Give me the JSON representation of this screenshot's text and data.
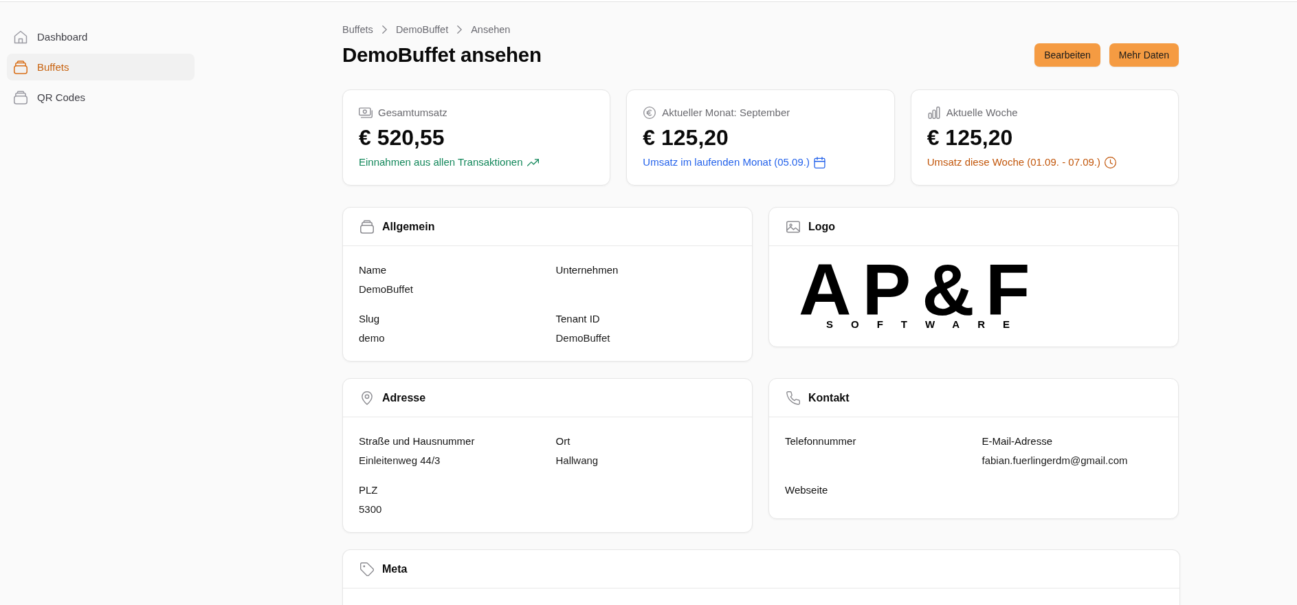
{
  "sidebar": {
    "items": [
      {
        "label": "Dashboard",
        "selected": false
      },
      {
        "label": "Buffets",
        "selected": true
      },
      {
        "label": "QR Codes",
        "selected": false
      }
    ]
  },
  "breadcrumbs": [
    "Buffets",
    "DemoBuffet",
    "Ansehen"
  ],
  "page": {
    "title": "DemoBuffet ansehen",
    "actions": [
      "Bearbeiten",
      "Mehr Daten"
    ]
  },
  "stats": [
    {
      "label": "Gesamtumsatz",
      "value": "€ 520,55",
      "note": "Einnahmen aus allen Transaktionen",
      "color": "#12875a"
    },
    {
      "label": "Aktueller Monat: September",
      "value": "€ 125,20",
      "note": "Umsatz im laufenden Monat (05.09.)",
      "color": "#2563eb"
    },
    {
      "label": "Aktuelle Woche",
      "value": "€ 125,20",
      "note": "Umsatz diese Woche (01.09. - 07.09.)",
      "color": "#c2570c"
    }
  ],
  "panels": [
    {
      "kind": "fields",
      "title": "Allgemein",
      "fields": [
        {
          "label": "Name",
          "value": "DemoBuffet"
        },
        {
          "label": "Unternehmen"
        },
        {
          "label": "Slug",
          "value": "demo"
        },
        {
          "label": "Tenant ID",
          "value": "DemoBuffet"
        }
      ]
    },
    {
      "kind": "logo",
      "title": "Logo",
      "logo": {
        "wordmark": "AP&F",
        "tagline": "SOFTWARE"
      }
    },
    {
      "kind": "fields",
      "title": "Adresse",
      "fields": [
        {
          "label": "Straße und Hausnummer",
          "value": "Einleitenweg 44/3"
        },
        {
          "label": "Ort",
          "value": "Hallwang"
        },
        {
          "label": "PLZ",
          "value": "5300"
        }
      ]
    },
    {
      "kind": "fields",
      "title": "Kontakt",
      "fields": [
        {
          "label": "Telefonnummer"
        },
        {
          "label": "E-Mail-Adresse",
          "value": "fabian.fuerlingerdm@gmail.com"
        },
        {
          "label": "Webseite"
        }
      ]
    }
  ],
  "meta": {
    "title": "Meta"
  }
}
